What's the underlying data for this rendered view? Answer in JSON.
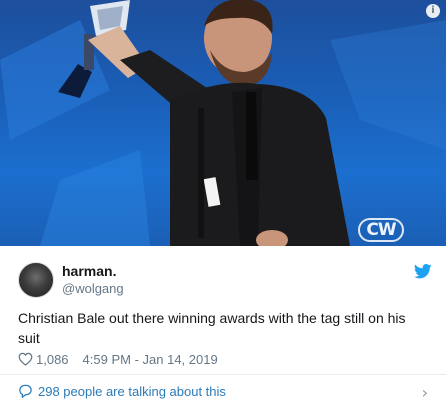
{
  "media": {
    "watermark": "CW"
  },
  "author": {
    "display_name": "harman.",
    "handle": "@wolgang"
  },
  "tweet": {
    "text": "Christian Bale out there winning awards with the tag still on his suit",
    "likes": "1,086",
    "timestamp": "4:59 PM - Jan 14, 2019"
  },
  "footer": {
    "talking_text": "298 people are talking about this"
  },
  "colors": {
    "link_blue": "#2b7bb9",
    "twitter_blue": "#1da1f2",
    "muted_gray": "#657786"
  }
}
